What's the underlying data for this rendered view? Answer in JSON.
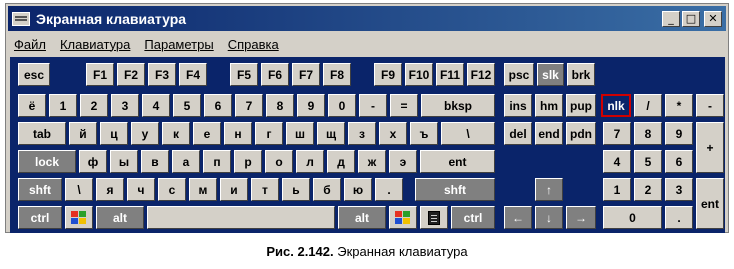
{
  "window": {
    "title": "Экранная клавиатура",
    "controls": {
      "minimize": "_",
      "maximize": "□",
      "close": "✕"
    }
  },
  "menu": [
    "Файл",
    "Клавиатура",
    "Параметры",
    "Справка"
  ],
  "keys": {
    "esc": "esc",
    "f1": "F1",
    "f2": "F2",
    "f3": "F3",
    "f4": "F4",
    "f5": "F5",
    "f6": "F6",
    "f7": "F7",
    "f8": "F8",
    "f9": "F9",
    "f10": "F10",
    "f11": "F11",
    "f12": "F12",
    "psc": "psc",
    "slk": "slk",
    "brk": "brk",
    "yo": "ё",
    "d1": "1",
    "d2": "2",
    "d3": "3",
    "d4": "4",
    "d5": "5",
    "d6": "6",
    "d7": "7",
    "d8": "8",
    "d9": "9",
    "d0": "0",
    "minus": "-",
    "equals": "=",
    "bksp": "bksp",
    "ins": "ins",
    "hm": "hm",
    "pup": "pup",
    "nlk": "nlk",
    "np_div": "/",
    "np_mul": "*",
    "np_sub": "-",
    "tab": "tab",
    "q1": "й",
    "q2": "ц",
    "q3": "у",
    "q4": "к",
    "q5": "е",
    "q6": "н",
    "q7": "г",
    "q8": "ш",
    "q9": "щ",
    "q10": "з",
    "q11": "х",
    "q12": "ъ",
    "q13": "\\",
    "del": "del",
    "end": "end",
    "pdn": "pdn",
    "np7": "7",
    "np8": "8",
    "np9": "9",
    "np_add": "+",
    "lock": "lock",
    "a1": "ф",
    "a2": "ы",
    "a3": "в",
    "a4": "а",
    "a5": "п",
    "a6": "р",
    "a7": "о",
    "a8": "л",
    "a9": "д",
    "a10": "ж",
    "a11": "э",
    "ent": "ent",
    "np4": "4",
    "np5": "5",
    "np6": "6",
    "shft": "shft",
    "z0": "\\",
    "z1": "я",
    "z2": "ч",
    "z3": "с",
    "z4": "м",
    "z5": "и",
    "z6": "т",
    "z7": "ь",
    "z8": "б",
    "z9": "ю",
    "z10": ".",
    "rshft": "shft",
    "up": "↑",
    "np1": "1",
    "np2": "2",
    "np3": "3",
    "np_ent": "ent",
    "ctrl": "ctrl",
    "alt": "alt",
    "ralt": "alt",
    "rctrl": "ctrl",
    "left": "←",
    "down": "↓",
    "right": "→",
    "np0": "0",
    "np_dot": "."
  },
  "caption": {
    "label": "Рис. 2.142.",
    "text": " Экранная клавиатура"
  }
}
